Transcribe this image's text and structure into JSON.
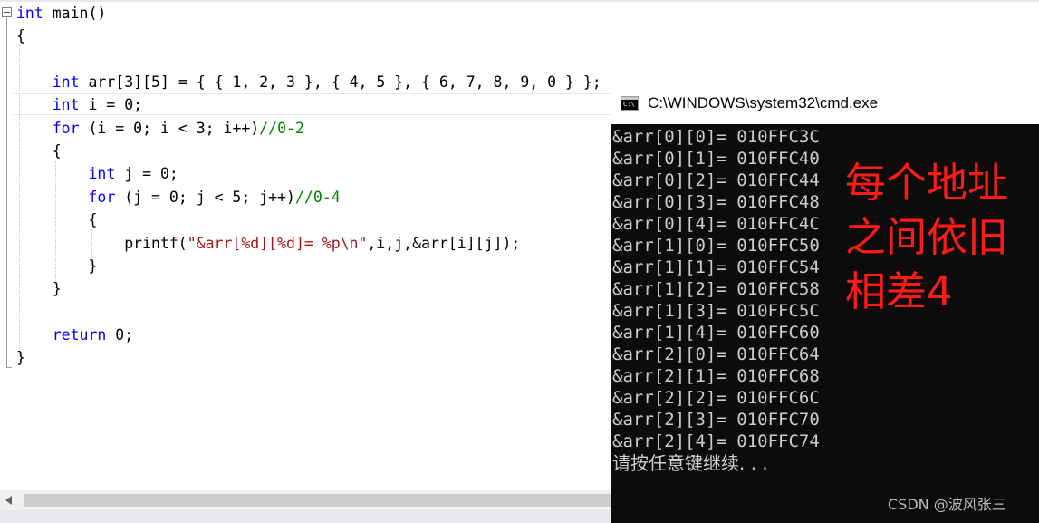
{
  "editor": {
    "code_lines": [
      {
        "tokens": [
          {
            "t": "int",
            "c": "kw"
          },
          {
            "t": " main()",
            "c": ""
          }
        ]
      },
      {
        "tokens": [
          {
            "t": "{",
            "c": ""
          }
        ]
      },
      {
        "tokens": []
      },
      {
        "tokens": [
          {
            "t": "    ",
            "c": ""
          },
          {
            "t": "int",
            "c": "kw"
          },
          {
            "t": " arr[3][5] = { { 1, 2, 3 }, { 4, 5 }, { 6, 7, 8, 9, 0 } };",
            "c": ""
          }
        ]
      },
      {
        "tokens": [
          {
            "t": "    ",
            "c": ""
          },
          {
            "t": "int",
            "c": "kw"
          },
          {
            "t": " i = 0;",
            "c": ""
          }
        ]
      },
      {
        "tokens": [
          {
            "t": "    ",
            "c": ""
          },
          {
            "t": "for",
            "c": "kw"
          },
          {
            "t": " (i = 0; i < 3; i++)",
            "c": ""
          },
          {
            "t": "//0-2",
            "c": "cm"
          }
        ]
      },
      {
        "tokens": [
          {
            "t": "    {",
            "c": ""
          }
        ]
      },
      {
        "tokens": [
          {
            "t": "        ",
            "c": ""
          },
          {
            "t": "int",
            "c": "kw"
          },
          {
            "t": " j = 0;",
            "c": ""
          }
        ]
      },
      {
        "tokens": [
          {
            "t": "        ",
            "c": ""
          },
          {
            "t": "for",
            "c": "kw"
          },
          {
            "t": " (j = 0; j < 5; j++)",
            "c": ""
          },
          {
            "t": "//0-4",
            "c": "cm"
          }
        ]
      },
      {
        "tokens": [
          {
            "t": "        {",
            "c": ""
          }
        ]
      },
      {
        "tokens": [
          {
            "t": "            printf(",
            "c": ""
          },
          {
            "t": "\"&arr[%d][%d]= %p\\n\"",
            "c": "str"
          },
          {
            "t": ",i,j,&arr[i][j]);",
            "c": ""
          }
        ]
      },
      {
        "tokens": [
          {
            "t": "        }",
            "c": ""
          }
        ]
      },
      {
        "tokens": [
          {
            "t": "    }",
            "c": ""
          }
        ]
      },
      {
        "tokens": []
      },
      {
        "tokens": [
          {
            "t": "    ",
            "c": ""
          },
          {
            "t": "return",
            "c": "kw"
          },
          {
            "t": " 0;",
            "c": ""
          }
        ]
      },
      {
        "tokens": [
          {
            "t": "}",
            "c": ""
          }
        ]
      }
    ]
  },
  "console": {
    "title": "C:\\WINDOWS\\system32\\cmd.exe",
    "icon_text": "C:\\",
    "output_lines": [
      "&arr[0][0]= 010FFC3C",
      "&arr[0][1]= 010FFC40",
      "&arr[0][2]= 010FFC44",
      "&arr[0][3]= 010FFC48",
      "&arr[0][4]= 010FFC4C",
      "&arr[1][0]= 010FFC50",
      "&arr[1][1]= 010FFC54",
      "&arr[1][2]= 010FFC58",
      "&arr[1][3]= 010FFC5C",
      "&arr[1][4]= 010FFC60",
      "&arr[2][0]= 010FFC64",
      "&arr[2][1]= 010FFC68",
      "&arr[2][2]= 010FFC6C",
      "&arr[2][3]= 010FFC70",
      "&arr[2][4]= 010FFC74"
    ],
    "prompt": "请按任意键继续. . .",
    "annotation_lines": [
      "每个地址",
      "之间依旧",
      "相差4"
    ],
    "watermark": "CSDN @波风张三"
  },
  "colors": {
    "keyword": "#0000ff",
    "string": "#a31515",
    "comment": "#008000",
    "console_bg": "#0c0c0c",
    "console_text": "#cccccc",
    "annotation": "#ff1a1a"
  }
}
